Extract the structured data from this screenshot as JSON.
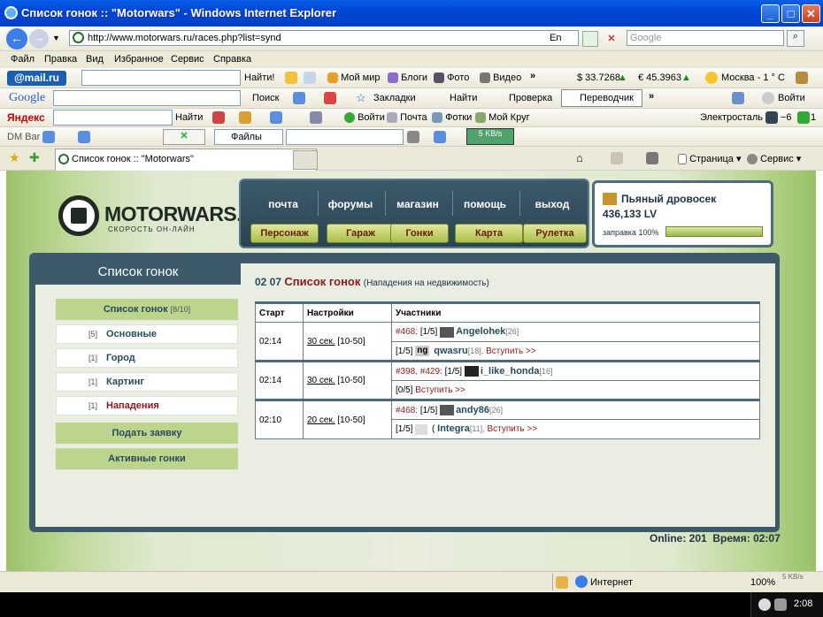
{
  "window": {
    "title": "Список гонок :: \"Motorwars\" - Windows Internet Explorer"
  },
  "address": {
    "url": "http://www.motorwars.ru/races.php?list=synd",
    "search_placeholder": "Google",
    "lang": "En"
  },
  "menu": [
    "Файл",
    "Правка",
    "Вид",
    "Избранное",
    "Сервис",
    "Справка"
  ],
  "mailbar": {
    "logo": "@mail.ru",
    "find": "Найти!",
    "items": [
      "Мой мир",
      "Блоги",
      "Фото",
      "Видео"
    ],
    "usd": "$ 33.7268",
    "eur": "€ 45.3963",
    "weather": "Москва - 1 ° С"
  },
  "googlebar": {
    "logo": "Google",
    "search": "Поиск",
    "bookmarks": "Закладки",
    "find": "Найти",
    "check": "Проверка",
    "translator": "Переводчик",
    "login": "Войти"
  },
  "yandexbar": {
    "logo": "Яндекс",
    "find": "Найти",
    "enter": "Войти",
    "mail": "Почта",
    "photos": "Фотки",
    "circle": "Мой Круг",
    "power": "Электросталь",
    "temp": "−6",
    "count": "1"
  },
  "dmbar": {
    "label": "DM Bar",
    "files": "Файлы",
    "speed": "5 KB/s"
  },
  "tabbar": {
    "tab": "Список гонок :: \"Motorwars\"",
    "page": "Страница",
    "service": "Сервис"
  },
  "site": {
    "logo": "MOTORWARS.RU",
    "slogan": "СКОРОСТЬ ОН-ЛАЙН",
    "nav_top": [
      "почта",
      "форумы",
      "магазин",
      "помощь",
      "выход"
    ],
    "nav_bottom": [
      "Персонаж",
      "Гараж",
      "Гонки",
      "Карта",
      "Рулетка"
    ],
    "user": {
      "name": "Пьяный дровосек",
      "money": "436,133 LV",
      "fuel_label": "заправка 100%",
      "fuel_pct": 100
    },
    "left_title": "Список гонок",
    "left_head": {
      "label": "Список гонок",
      "count": "[8/10]"
    },
    "left_items": [
      {
        "n": "[5]",
        "label": "Основные"
      },
      {
        "n": "[1]",
        "label": "Город"
      },
      {
        "n": "[1]",
        "label": "Картинг"
      },
      {
        "n": "[1]",
        "label": "Нападения"
      }
    ],
    "left_buttons": [
      "Подать заявку",
      "Активные гонки"
    ],
    "content_time": "02 07",
    "content_title": "Список гонок",
    "content_sub": "(Нападения на недвижимость)",
    "table": {
      "headers": [
        "Старт",
        "Настройки",
        "Участники"
      ],
      "rows": [
        {
          "start": "02:14",
          "set": "30 сек.",
          "range": "[10-50]",
          "l1": {
            "id": "#468:",
            "cnt": "[1/5]",
            "name": "Angelohek",
            "lvl": "[26]"
          },
          "l2": {
            "cnt": "[1/5]",
            "tag": "ng",
            "name": "qwasru",
            "lvl": "[18],",
            "join": "Вступить >>"
          }
        },
        {
          "start": "02:14",
          "set": "30 сек.",
          "range": "[10-50]",
          "l1": {
            "id": "#398, #429:",
            "cnt": "[1/5]",
            "name": "i_like_honda",
            "lvl": "[16]"
          },
          "l2": {
            "cnt": "[0/5]",
            "join": "Вступить >>"
          }
        },
        {
          "start": "02:10",
          "set": "20 сек.",
          "range": "[10-50]",
          "l1": {
            "id": "#468:",
            "cnt": "[1/5]",
            "name": "andy86",
            "lvl": "[26]"
          },
          "l2": {
            "cnt": "[1/5]",
            "tag": "(",
            "name": "Integra",
            "lvl": "[11],",
            "join": "Вступить >>"
          }
        }
      ]
    },
    "online": "Online: 201",
    "time": "Время: 02:07"
  },
  "status": {
    "zone": "Интернет",
    "zoom": "100%",
    "speed": "5 KB/s"
  },
  "taskbar": {
    "time": "2:08"
  }
}
